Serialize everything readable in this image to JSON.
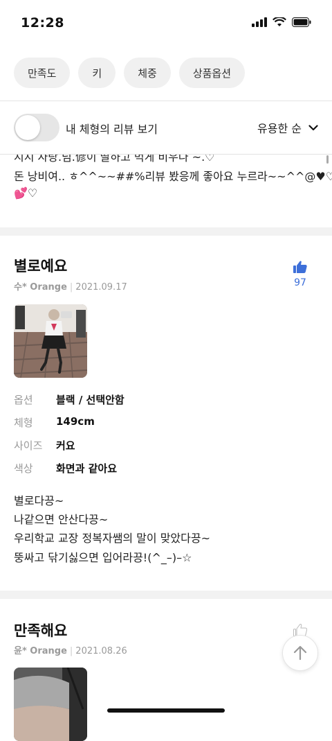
{
  "status_bar": {
    "time": "12:28"
  },
  "filters": [
    "만족도",
    "키",
    "체중",
    "상품옵션"
  ],
  "toggle": {
    "label": "내 체형의 리뷰 보기",
    "on": false
  },
  "sort": {
    "label": "유용한 순"
  },
  "clipped_review": {
    "lines": [
      "지지 자랑.넘.偐이 딸하고 먹게 비우나 ~.♡",
      "돈 낭비여.. ㅎ^^~~##%리뷰 봤응께 좋아요 누르라~~^^@♥♡/",
      "💕♡"
    ]
  },
  "reviews": [
    {
      "title": "별로예요",
      "author": "수* Orange",
      "date": "2021.09.17",
      "likes": "97",
      "attributes": [
        {
          "label": "옵션",
          "value": "블랙 / 선택안함"
        },
        {
          "label": "체형",
          "value": "149cm"
        },
        {
          "label": "사이즈",
          "value": "커요"
        },
        {
          "label": "색상",
          "value": "화면과 같아요"
        }
      ],
      "body": [
        "별로다끙~",
        "나같으면 안산다끙~",
        "우리학교 교장 정복자쌤의 말이 맞았다끙~",
        "뚱싸고 닦기싫으면 입어라끙!(^_–)–☆"
      ]
    },
    {
      "title": "만족해요",
      "author": "윤* Orange",
      "date": "2021.08.26"
    }
  ],
  "colors": {
    "accent": "#3d6fd9",
    "chip_bg": "#f0f0f0",
    "muted": "#9a9a9a"
  }
}
